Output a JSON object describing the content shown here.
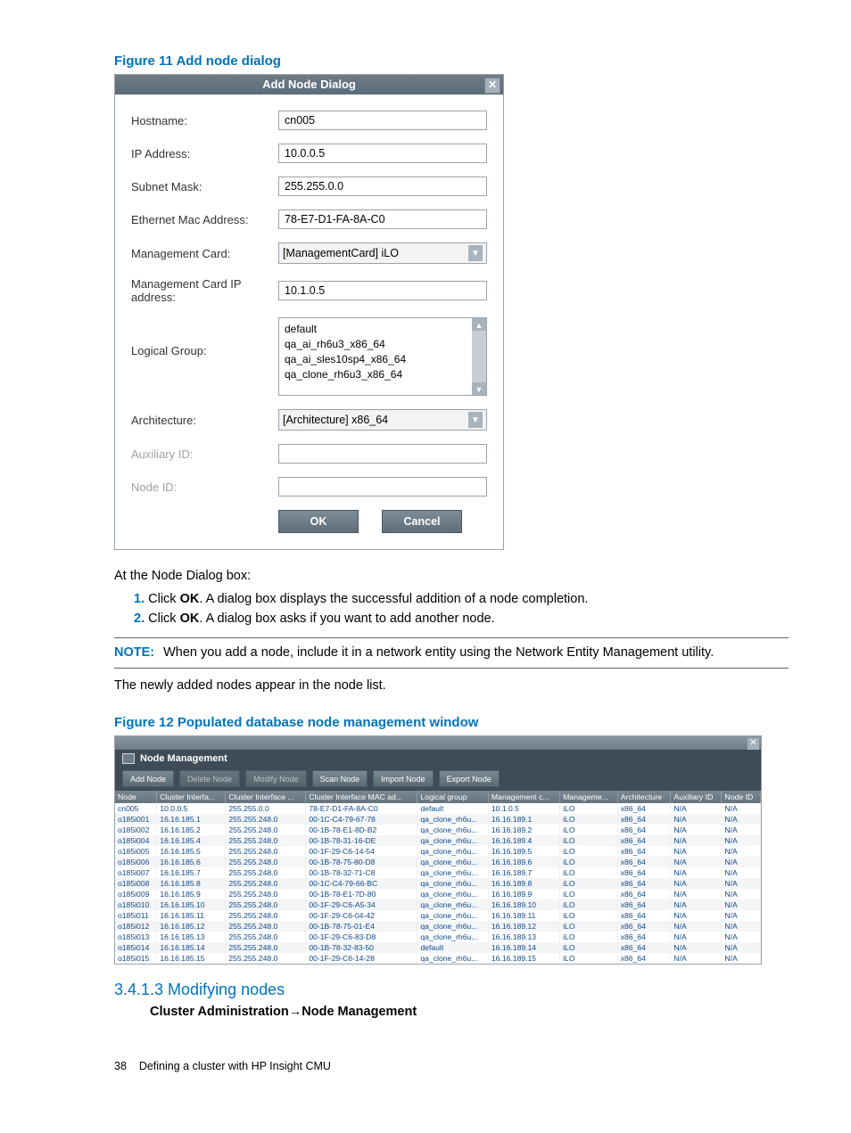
{
  "figure11_title": "Figure 11 Add node dialog",
  "dialog": {
    "title": "Add Node Dialog",
    "close_glyph": "✕",
    "fields": {
      "hostname": {
        "label": "Hostname:",
        "value": "cn005"
      },
      "ip": {
        "label": "IP Address:",
        "value": "10.0.0.5"
      },
      "subnet": {
        "label": "Subnet Mask:",
        "value": "255.255.0.0"
      },
      "mac": {
        "label": "Ethernet Mac Address:",
        "value": "78-E7-D1-FA-8A-C0"
      },
      "mgmt_card": {
        "label": "Management Card:",
        "selected": "[ManagementCard] iLO"
      },
      "mgmt_ip": {
        "label": "Management Card IP address:",
        "value": "10.1.0.5"
      },
      "logical_group": {
        "label": "Logical Group:",
        "options": [
          "default",
          "qa_ai_rh6u3_x86_64",
          "qa_ai_sles10sp4_x86_64",
          "qa_clone_rh6u3_x86_64"
        ]
      },
      "arch": {
        "label": "Architecture:",
        "selected": "[Architecture] x86_64"
      },
      "aux_id": {
        "label": "Auxiliary ID:"
      },
      "node_id": {
        "label": "Node ID:"
      }
    },
    "ok": "OK",
    "cancel": "Cancel"
  },
  "para_intro": "At the Node Dialog box:",
  "step1_pre": "Click ",
  "step1_bold": "OK",
  "step1_post": ". A dialog box displays the successful addition of a node completion.",
  "step2_pre": "Click ",
  "step2_bold": "OK",
  "step2_post": ". A dialog box asks if you want to add another node.",
  "note_label": "NOTE:",
  "note_text": "When you add a node, include it in a network entity using the Network Entity Management utility.",
  "para_after": "The newly added nodes appear in the node list.",
  "figure12_title": "Figure 12 Populated database node management window",
  "nm": {
    "title": "Node Management",
    "buttons": [
      "Add Node",
      "Delete Node",
      "Modify Node",
      "Scan Node",
      "Import Node",
      "Export Node"
    ],
    "headers": [
      "Node",
      "Cluster Interfa...",
      "Cluster Interface ...",
      "Cluster Interface MAC ad...",
      "Logical group",
      "Management c...",
      "Manageme...",
      "Architecture",
      "Auxiliary ID",
      "Node ID"
    ],
    "rows": [
      [
        "cn005",
        "10.0.0.5",
        "255.255.0.0",
        "78-E7-D1-FA-8A-C0",
        "default",
        "10.1.0.5",
        "iLO",
        "x86_64",
        "N/A",
        "N/A"
      ],
      [
        "o185i001",
        "16.16.185.1",
        "255.255.248.0",
        "00-1C-C4-79-67-78",
        "qa_clone_rh6u...",
        "16.16.189.1",
        "iLO",
        "x86_64",
        "N/A",
        "N/A"
      ],
      [
        "o185i002",
        "16.16.185.2",
        "255.255.248.0",
        "00-1B-78-E1-8D-B2",
        "qa_clone_rh6u...",
        "16.16.189.2",
        "iLO",
        "x86_64",
        "N/A",
        "N/A"
      ],
      [
        "o185i004",
        "16.16.185.4",
        "255.255.248.0",
        "00-1B-78-31-16-DE",
        "qa_clone_rh6u...",
        "16.16.189.4",
        "iLO",
        "x86_64",
        "N/A",
        "N/A"
      ],
      [
        "o185i005",
        "16.16.185.5",
        "255.255.248.0",
        "00-1F-29-C6-14-54",
        "qa_clone_rh6u...",
        "16.16.189.5",
        "iLO",
        "x86_64",
        "N/A",
        "N/A"
      ],
      [
        "o185i006",
        "16.16.185.6",
        "255.255.248.0",
        "00-1B-78-75-80-D8",
        "qa_clone_rh6u...",
        "16.16.189.6",
        "iLO",
        "x86_64",
        "N/A",
        "N/A"
      ],
      [
        "o185i007",
        "16.16.185.7",
        "255.255.248.0",
        "00-1B-78-32-71-C8",
        "qa_clone_rh6u...",
        "16.16.189.7",
        "iLO",
        "x86_64",
        "N/A",
        "N/A"
      ],
      [
        "o185i008",
        "16.16.185.8",
        "255.255.248.0",
        "00-1C-C4-79-66-BC",
        "qa_clone_rh6u...",
        "16.16.189.8",
        "iLO",
        "x86_64",
        "N/A",
        "N/A"
      ],
      [
        "o185i009",
        "16.16.185.9",
        "255.255.248.0",
        "00-1B-78-E1-7D-80",
        "qa_clone_rh6u...",
        "16.16.189.9",
        "iLO",
        "x86_64",
        "N/A",
        "N/A"
      ],
      [
        "o185i010",
        "16.16.185.10",
        "255.255.248.0",
        "00-1F-29-C6-A5-34",
        "qa_clone_rh6u...",
        "16.16.189.10",
        "iLO",
        "x86_64",
        "N/A",
        "N/A"
      ],
      [
        "o185i011",
        "16.16.185.11",
        "255.255.248.0",
        "00-1F-29-C6-04-42",
        "qa_clone_rh6u...",
        "16.16.189.11",
        "iLO",
        "x86_64",
        "N/A",
        "N/A"
      ],
      [
        "o185i012",
        "16.16.185.12",
        "255.255.248.0",
        "00-1B-78-75-01-E4",
        "qa_clone_rh6u...",
        "16.16.189.12",
        "iLO",
        "x86_64",
        "N/A",
        "N/A"
      ],
      [
        "o185i013",
        "16.16.185.13",
        "255.255.248.0",
        "00-1F-29-C6-83-D8",
        "qa_clone_rh6u...",
        "16.16.189.13",
        "iLO",
        "x86_64",
        "N/A",
        "N/A"
      ],
      [
        "o185i014",
        "16.16.185.14",
        "255.255.248.0",
        "00-1B-78-32-83-50",
        "default",
        "16.16.189.14",
        "iLO",
        "x86_64",
        "N/A",
        "N/A"
      ],
      [
        "o185i015",
        "16.16.185.15",
        "255.255.248.0",
        "00-1F-29-C6-14-28",
        "qa_clone_rh6u...",
        "16.16.189.15",
        "iLO",
        "x86_64",
        "N/A",
        "N/A"
      ]
    ]
  },
  "sect_heading": "3.4.1.3 Modifying nodes",
  "breadcrumb_a": "Cluster Administration",
  "breadcrumb_arrow": "→",
  "breadcrumb_b": "Node Management",
  "footer_page": "38",
  "footer_text": "Defining a cluster with HP Insight CMU"
}
